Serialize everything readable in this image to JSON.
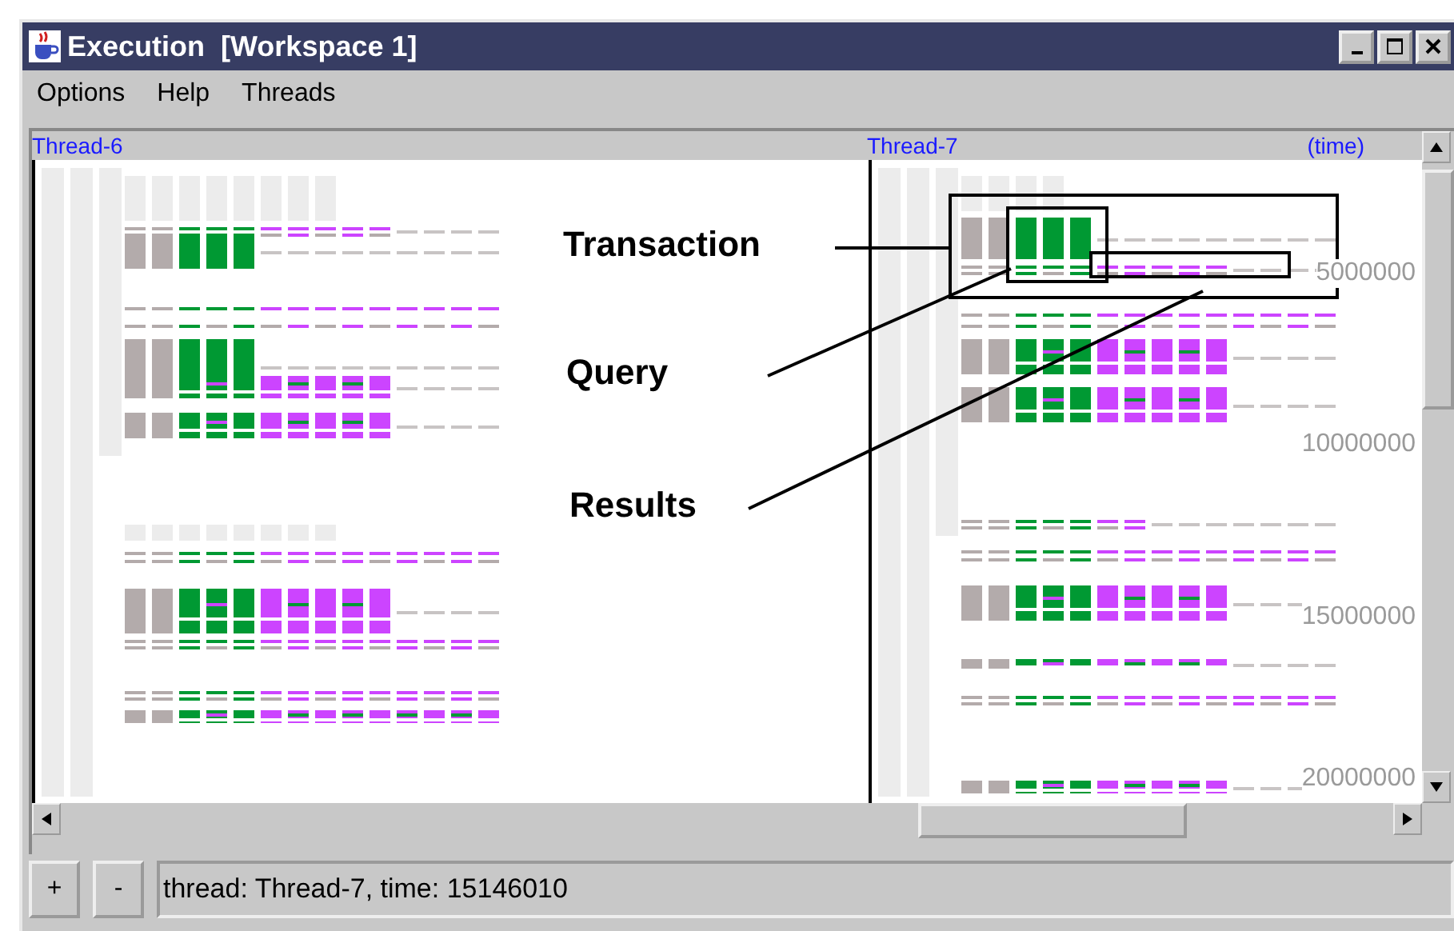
{
  "window": {
    "title": "Execution  [Workspace 1]"
  },
  "menu": [
    "Options",
    "Help",
    "Threads"
  ],
  "threads": [
    {
      "label": "Thread-6"
    },
    {
      "label": "Thread-7"
    }
  ],
  "time_axis": {
    "label": "(time)",
    "ticks": [
      "5000000",
      "10000000",
      "15000000",
      "20000000"
    ]
  },
  "annotations": [
    {
      "label": "Transaction"
    },
    {
      "label": "Query"
    },
    {
      "label": "Results"
    }
  ],
  "zoom_buttons": [
    "+",
    "-"
  ],
  "status": "thread: Thread-7, time: 15146010"
}
